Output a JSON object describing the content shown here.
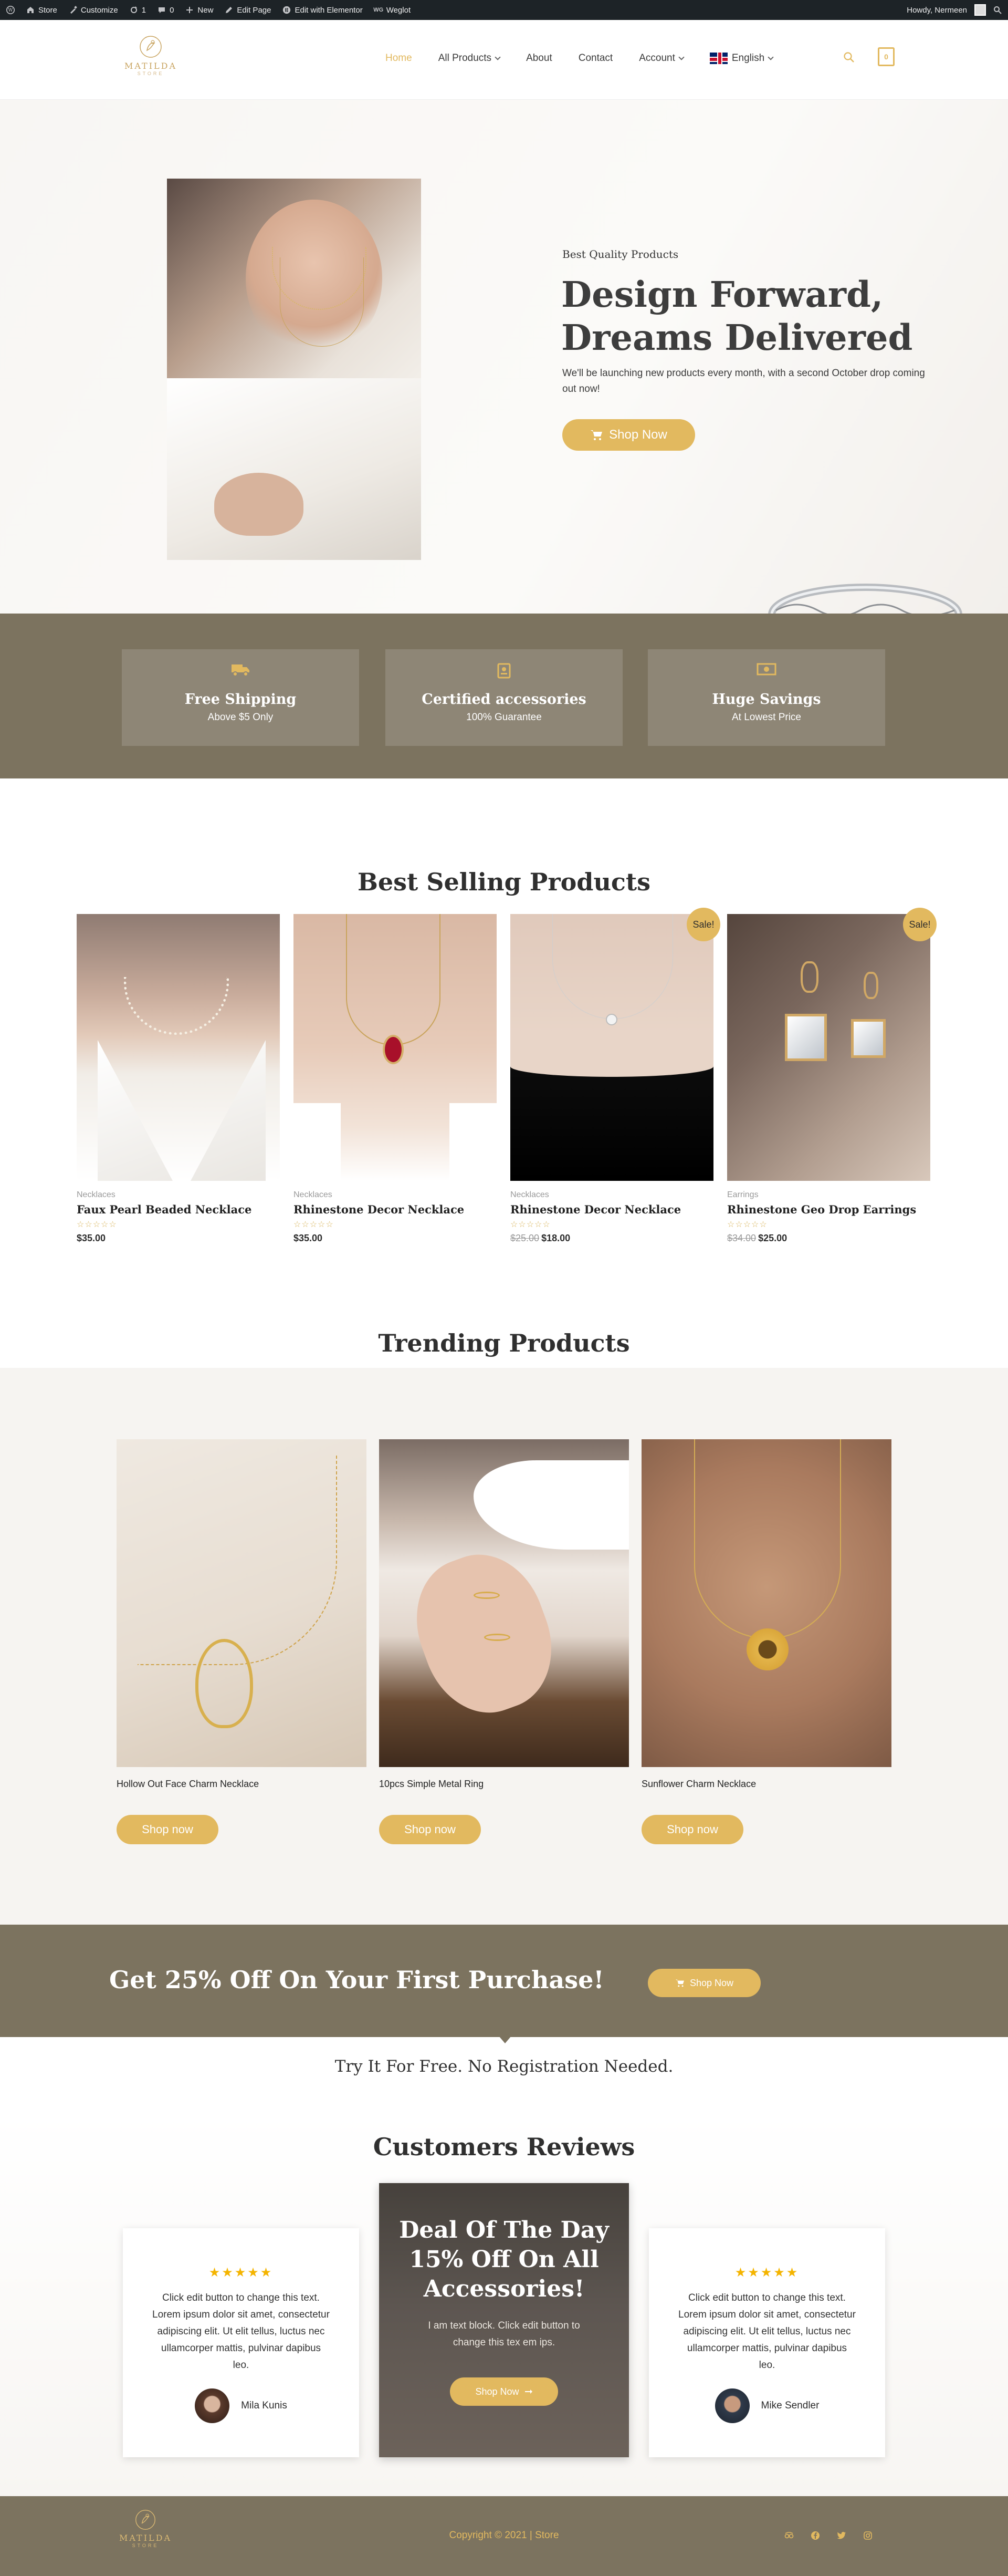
{
  "admin_bar": {
    "site": "Store",
    "customize": "Customize",
    "updates": "1",
    "comments": "0",
    "new": "New",
    "edit_page": "Edit Page",
    "edit_elementor": "Edit with Elementor",
    "weglot": "Weglot",
    "howdy": "Howdy, Nermeen"
  },
  "header": {
    "logo_text": "MATILDA",
    "logo_sub": "STORE",
    "nav": {
      "home": "Home",
      "all_products": "All Products",
      "about": "About",
      "contact": "Contact",
      "account": "Account",
      "language": "English"
    },
    "cart_count": "0"
  },
  "hero": {
    "kicker": "Best Quality Products",
    "title_line1": "Design Forward,",
    "title_line2": "Dreams Delivered",
    "text": "We'll be launching new products every month, with a second October drop coming out now!",
    "button": "Shop Now"
  },
  "features": [
    {
      "title": "Free Shipping",
      "subtitle": "Above $5 Only",
      "icon": "truck-icon"
    },
    {
      "title": "Certified accessories",
      "subtitle": "100% Guarantee",
      "icon": "certificate-icon"
    },
    {
      "title": "Huge Savings",
      "subtitle": "At Lowest Price",
      "icon": "money-icon"
    }
  ],
  "best_selling": {
    "title": "Best Selling Products",
    "sale_badge": "Sale!",
    "products": [
      {
        "category": "Necklaces",
        "name": "Faux Pearl Beaded Necklace",
        "price": "$35.00",
        "old_price": "",
        "sale": false
      },
      {
        "category": "Necklaces",
        "name": "Rhinestone Decor Necklace",
        "price": "$35.00",
        "old_price": "",
        "sale": false
      },
      {
        "category": "Necklaces",
        "name": "Rhinestone Decor Necklace",
        "price": "$18.00",
        "old_price": "$25.00",
        "sale": true
      },
      {
        "category": "Earrings",
        "name": "Rhinestone Geo Drop Earrings",
        "price": "$25.00",
        "old_price": "$34.00",
        "sale": true
      }
    ]
  },
  "trending": {
    "title": "Trending Products",
    "button": "Shop now",
    "products": [
      {
        "name": "Hollow Out Face Charm Necklace"
      },
      {
        "name": "10pcs Simple Metal Ring"
      },
      {
        "name": "Sunflower Charm Necklace"
      }
    ]
  },
  "promo": {
    "text": "Get 25% Off On Your First Purchase!",
    "button": "Shop Now",
    "subtext": "Try It For Free. No Registration Needed."
  },
  "reviews": {
    "title": "Customers Reviews",
    "stars": "★★★★★",
    "items": [
      {
        "text": "Click edit button to change this text. Lorem ipsum dolor sit amet, consectetur adipiscing elit. Ut elit tellus, luctus nec ullamcorper mattis, pulvinar dapibus leo.",
        "name": "Mila Kunis"
      },
      {
        "text": "Click edit button to change this text. Lorem ipsum dolor sit amet, consectetur adipiscing elit. Ut elit tellus, luctus nec ullamcorper mattis, pulvinar dapibus leo.",
        "name": "Mike Sendler"
      }
    ],
    "deal": {
      "title_line1": "Deal Of The Day",
      "title_line2": "15% Off On All",
      "title_line3": "Accessories!",
      "text": "I am text block. Click edit button to change this tex em ips.",
      "button": "Shop Now"
    }
  },
  "footer": {
    "logo_text": "MATILDA",
    "logo_sub": "STORE",
    "copyright": "Copyright © 2021 | Store"
  },
  "colors": {
    "accent": "#e2b95f",
    "band": "#7c735f",
    "admin_bar": "#1d2327"
  }
}
